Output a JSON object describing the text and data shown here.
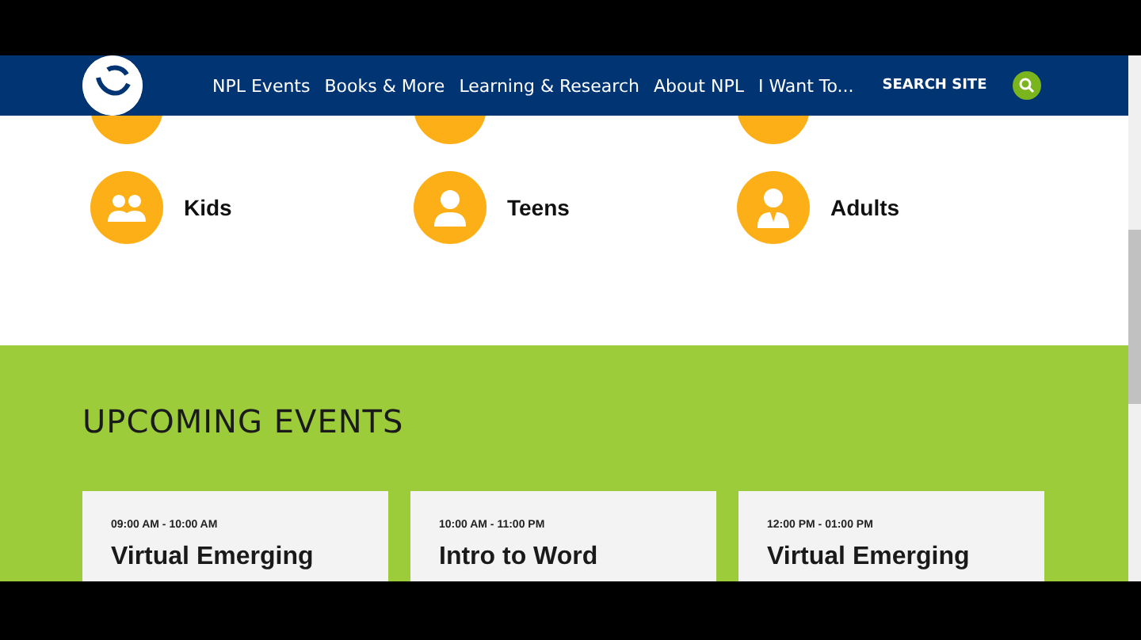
{
  "nav": {
    "items": [
      "NPL Events",
      "Books & More",
      "Learning & Research",
      "About NPL",
      "I Want To..."
    ],
    "search_label": "SEARCH SITE"
  },
  "audiences": [
    {
      "label": "Kids",
      "kind": "kids"
    },
    {
      "label": "Teens",
      "kind": "teens"
    },
    {
      "label": "Adults",
      "kind": "adults"
    }
  ],
  "events_section": {
    "title": "UPCOMING EVENTS",
    "events": [
      {
        "time": "09:00 AM - 10:00 AM",
        "title": "Virtual Emerging"
      },
      {
        "time": "10:00 AM - 11:00 PM",
        "title": "Intro to Word"
      },
      {
        "time": "12:00 PM - 01:00 PM",
        "title": "Virtual Emerging"
      }
    ]
  }
}
